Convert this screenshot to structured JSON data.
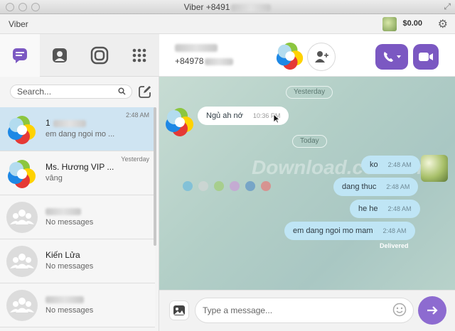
{
  "window": {
    "title": "Viber +8491"
  },
  "appbar": {
    "app_name": "Viber",
    "balance": "$0.00"
  },
  "tabs": [
    {
      "name": "chats-tab"
    },
    {
      "name": "contacts-tab"
    },
    {
      "name": "public-chats-tab"
    },
    {
      "name": "dialpad-tab"
    }
  ],
  "search": {
    "placeholder": "Search..."
  },
  "conversations": [
    {
      "name": "1",
      "preview": "em dang ngoi mo ...",
      "time": "2:48 AM",
      "selected": true
    },
    {
      "name": "Ms. Hương VIP ...",
      "preview": "vâng",
      "time": "Yesterday"
    },
    {
      "name": "",
      "preview": "No messages",
      "time": ""
    },
    {
      "name": "Kiến Lửa",
      "preview": "No messages",
      "time": ""
    },
    {
      "name": "",
      "preview": "No messages",
      "time": ""
    }
  ],
  "chat_header": {
    "phone": "+84978"
  },
  "chat": {
    "day_yesterday": "Yesterday",
    "day_today": "Today",
    "incoming": {
      "text": "Ngủ ah nớ",
      "time": "10:36 PM"
    },
    "outgoing": [
      {
        "text": "ko",
        "time": "2:48 AM"
      },
      {
        "text": "dang thuc",
        "time": "2:48 AM"
      },
      {
        "text": "he he",
        "time": "2:48 AM"
      },
      {
        "text": "em dang ngoi mo mam",
        "time": "2:48 AM"
      }
    ],
    "status": "Delivered",
    "watermark": "Download.com.vn"
  },
  "composer": {
    "placeholder": "Type a message..."
  },
  "colors": {
    "accent": "#7b58c2",
    "selected_row": "#cfe4f2",
    "outgoing_bubble": "#bfe5f5"
  }
}
